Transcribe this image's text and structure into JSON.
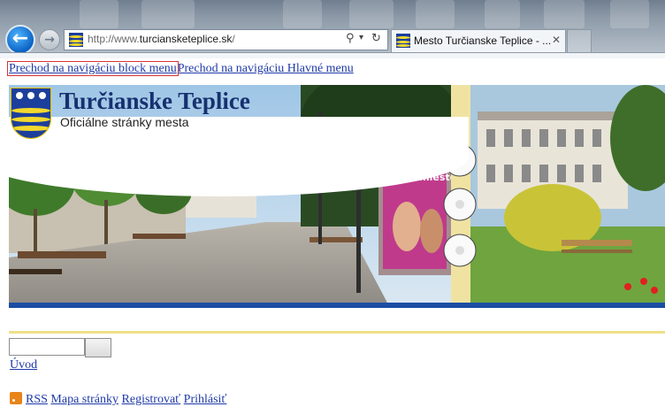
{
  "browser": {
    "address_url_prefix": "http://www.",
    "address_url_domain": "turciansketeplice.sk",
    "address_url_suffix": "/",
    "search_glyph": "⚲",
    "dropdown_glyph": "▾",
    "refresh_glyph": "↻",
    "back_glyph": "←",
    "forward_glyph": "→",
    "tab_title": "Mesto Turčianske Teplice - ...",
    "tab_close_glyph": "✕"
  },
  "skip_links": {
    "block_menu": "Prechod na navigáciu block menu",
    "main_menu": "Prechod na navigáciu Hlavné menu"
  },
  "header": {
    "title": "Turčianske Teplice",
    "subtitle": "Oficiálne stránky mesta",
    "banner_poster_text": "Vaše miesto oddychu!"
  },
  "nav": {
    "home": "Úvod"
  },
  "footer_links": {
    "rss": "RSS",
    "sitemap": "Mapa stránky",
    "register": "Registrovať",
    "login": "Prihlásiť"
  },
  "colors": {
    "link": "#1e3aa8",
    "crest_blue": "#1d3f9c",
    "crest_yellow": "#f4d92c",
    "band_blue": "#0d3a86"
  }
}
